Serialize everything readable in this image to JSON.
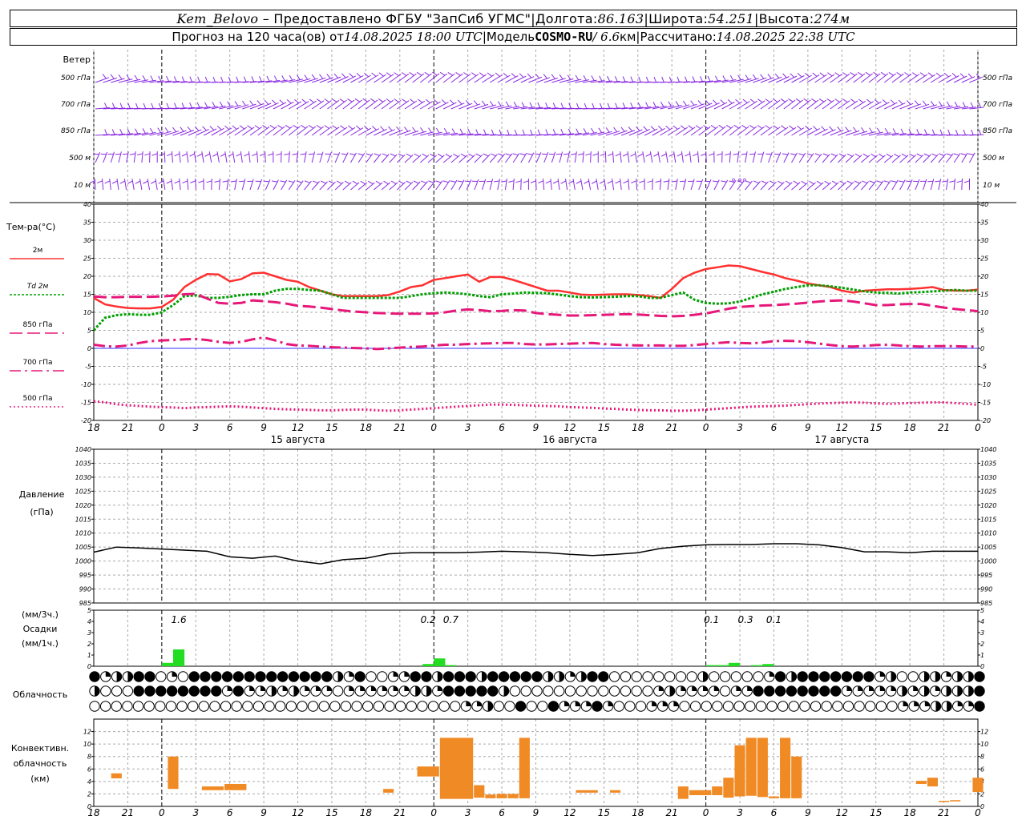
{
  "header": {
    "station": "Kem_Belovo",
    "sep0": " – ",
    "provided": "Предоставлено ФГБУ \"ЗапСиб УГМС\"",
    "lon_label": "Долгота:",
    "lon_value": "86.163",
    "lat_label": "Широта:",
    "lat_value": "54.251",
    "alt_label": "Высота:",
    "alt_value": "274м",
    "forecast_label": "Прогноз на 120 часа(ов) от",
    "forecast_from": "14.08.2025 18:00 UTC",
    "model_label": "Модель",
    "model_name": "COSMO-RU",
    "model_res": "/ 6.6",
    "model_res_unit": "км",
    "calc_label": "Рассчитано:",
    "calc_value": "14.08.2025 22:38 UTC",
    "bar": "|"
  },
  "colors": {
    "wind": "#8a2be2",
    "t2m": "#ff3030",
    "td2m": "#00a000",
    "t850": "#e6187a",
    "t700": "#e6187a",
    "t500": "#e6187a",
    "zero_line": "#3030ff",
    "precip": "#22dd22",
    "conv": "#f08a24",
    "grid": "#aaaaaa"
  },
  "chart_data": [
    {
      "type": "wind_barbs",
      "title": "Ветер",
      "levels": [
        "500 гПа",
        "700 гПа",
        "850 гПа",
        "500 м",
        "10  м"
      ],
      "x_ticks": [
        "18",
        "21",
        "0",
        "3",
        "6",
        "9",
        "12",
        "15",
        "18",
        "21",
        "0",
        "3",
        "6",
        "9",
        "12",
        "15",
        "18",
        "21",
        "0",
        "3",
        "6",
        "9",
        "12",
        "15",
        "18",
        "21",
        "0"
      ]
    },
    {
      "type": "line",
      "title": "Тем-ра(°C)",
      "ylim": [
        -20,
        40
      ],
      "y_ticks": [
        40,
        35,
        30,
        25,
        20,
        15,
        10,
        5,
        0,
        -5,
        -10,
        -15,
        -20
      ],
      "x_hours": [
        0,
        1,
        2,
        3,
        4,
        5,
        6,
        7,
        8,
        9,
        10,
        11,
        12,
        13,
        14,
        15,
        16,
        17,
        18,
        19,
        20,
        21,
        22,
        23,
        24,
        25,
        26,
        27,
        28,
        29,
        30,
        31,
        32,
        33,
        34,
        35,
        36,
        37,
        38,
        39,
        40,
        41,
        42,
        43,
        44,
        45,
        46,
        47,
        48,
        49,
        50,
        51,
        52,
        53,
        54,
        55,
        56,
        57,
        58,
        59,
        60,
        61,
        62,
        63,
        64,
        65,
        66,
        67,
        68,
        69,
        70,
        71,
        72,
        73,
        74,
        75,
        76,
        77,
        78
      ],
      "series": [
        {
          "name": "2м",
          "style": "solid",
          "values": [
            14,
            12.2,
            11.6,
            11.2,
            11.1,
            11.1,
            11.5,
            13.5,
            17,
            19,
            20.6,
            20.5,
            18.6,
            19.2,
            20.8,
            21,
            20,
            19,
            18.5,
            17,
            16,
            15,
            14.5,
            14.5,
            14.5,
            14.5,
            14.8,
            15.8,
            17,
            17.5,
            19,
            19.5,
            20,
            20.5,
            18.5,
            19.8,
            19.8,
            19,
            18,
            17,
            16,
            16,
            15.5,
            14.9,
            14.8,
            14.9,
            15,
            15,
            14.8,
            14.5,
            14,
            16.5,
            19.5,
            21,
            22,
            22.5,
            23,
            22.8,
            22,
            21.2,
            20.5,
            19.5,
            18.8,
            18,
            17.5,
            17,
            16,
            15.5,
            16,
            16.2,
            16.4,
            16.4,
            16.5,
            16.7,
            17,
            16.2,
            16,
            16,
            16.3
          ]
        },
        {
          "name": "Td  2м",
          "style": "dotted",
          "values": [
            5,
            8.5,
            9.2,
            9.5,
            9.3,
            9.3,
            10,
            12,
            14.5,
            14.7,
            14,
            14,
            14.3,
            14.8,
            15,
            15,
            16,
            16.5,
            16.5,
            16.2,
            16,
            15,
            14,
            14,
            14,
            14,
            14,
            14,
            14.5,
            15,
            15.3,
            15.5,
            15.3,
            15,
            14.5,
            14.2,
            15,
            15.2,
            15.5,
            15.4,
            15.3,
            14.9,
            14.5,
            14.2,
            14.1,
            14.2,
            14.3,
            14.5,
            14.5,
            14,
            14,
            14.8,
            15.5,
            13.5,
            12.6,
            12.4,
            12.5,
            13,
            14,
            15,
            15.7,
            16.5,
            17,
            17.5,
            17.5,
            17.2,
            16.8,
            16.3,
            15.8,
            15.5,
            15.4,
            15.2,
            15.5,
            15.6,
            15.8,
            16,
            16.2,
            16,
            16
          ]
        },
        {
          "name": "850 гПа",
          "style": "longdash",
          "values": [
            14.4,
            14.2,
            14.2,
            14.3,
            14.3,
            14.3,
            14.4,
            14.6,
            15,
            15.1,
            13.8,
            12.6,
            12.4,
            12.6,
            13.3,
            13.1,
            12.8,
            12.4,
            11.8,
            11.6,
            11.3,
            10.9,
            10.5,
            10.2,
            10,
            9.8,
            9.7,
            9.6,
            9.6,
            9.6,
            9.7,
            10,
            10.5,
            10.8,
            10.6,
            10.3,
            10.4,
            10.6,
            10.5,
            9.8,
            9.5,
            9.3,
            9.1,
            9.1,
            9.2,
            9.3,
            9.4,
            9.5,
            9.4,
            9.2,
            9.0,
            8.9,
            9.0,
            9.3,
            9.7,
            10.3,
            11,
            11.5,
            11.7,
            11.9,
            12,
            12.2,
            12.4,
            12.7,
            13,
            13.2,
            13.3,
            13,
            12.5,
            12,
            12,
            12.2,
            12.3,
            12.3,
            11.8,
            11.3,
            10.9,
            10.6,
            10.3
          ]
        },
        {
          "name": "700 гПа",
          "style": "dashdot",
          "values": [
            1.0,
            0.6,
            0.5,
            0.8,
            1.5,
            2,
            2.2,
            2.3,
            2.5,
            2.6,
            2.3,
            1.8,
            1.5,
            1.8,
            2.5,
            3,
            2.2,
            1.2,
            0.8,
            0.7,
            0.5,
            0.3,
            0.2,
            0.1,
            0,
            -0.2,
            0,
            0.2,
            0.4,
            0.5,
            0.8,
            1,
            1,
            1.2,
            1.3,
            1.4,
            1.5,
            1.5,
            1.2,
            1.1,
            1.1,
            1.2,
            1.3,
            1.4,
            1.5,
            1.2,
            1.0,
            0.9,
            0.8,
            0.8,
            0.8,
            0.7,
            0.7,
            0.9,
            1.2,
            1.5,
            1.7,
            1.5,
            1.4,
            1.6,
            2,
            2.1,
            2.0,
            1.7,
            1.3,
            0.9,
            0.6,
            0.5,
            0.7,
            0.9,
            1.0,
            0.8,
            0.6,
            0.5,
            0.6,
            0.6,
            0.6,
            0.5,
            0.5
          ]
        },
        {
          "name": "500 гПа",
          "style": "dotted2",
          "values": [
            -14.7,
            -15,
            -15.5,
            -15.8,
            -16,
            -16.2,
            -16.3,
            -16.4,
            -16.6,
            -16.4,
            -16.3,
            -16.2,
            -16.1,
            -16.2,
            -16.4,
            -16.6,
            -16.8,
            -16.9,
            -17,
            -17.1,
            -17.2,
            -17.2,
            -17.1,
            -17,
            -17,
            -17.2,
            -17.3,
            -17.2,
            -17,
            -16.8,
            -16.6,
            -16.4,
            -16.2,
            -16,
            -15.8,
            -15.6,
            -15.6,
            -15.7,
            -15.8,
            -15.9,
            -16,
            -16.1,
            -16.3,
            -16.4,
            -16.5,
            -16.7,
            -16.8,
            -17,
            -17.1,
            -17.2,
            -17.2,
            -17.3,
            -17.3,
            -17.2,
            -17,
            -16.8,
            -16.6,
            -16.4,
            -16.2,
            -16.1,
            -16,
            -15.9,
            -15.7,
            -15.5,
            -15.3,
            -15.2,
            -15.1,
            -15,
            -15.1,
            -15.3,
            -15.4,
            -15.3,
            -15.2,
            -15.1,
            -15,
            -15,
            -15.2,
            -15.4,
            -15.7
          ]
        }
      ],
      "x_ticks": [
        "18",
        "21",
        "0",
        "3",
        "6",
        "9",
        "12",
        "15",
        "18",
        "21",
        "0",
        "3",
        "6",
        "9",
        "12",
        "15",
        "18",
        "21",
        "0",
        "3",
        "6",
        "9",
        "12",
        "15",
        "18",
        "21",
        "0"
      ],
      "day_labels": [
        "15 августа",
        "16 августа",
        "17 августа"
      ]
    },
    {
      "type": "line",
      "title": "Давление",
      "ylabel": "(гПа)",
      "ylim": [
        985,
        1040
      ],
      "y_ticks": [
        1040,
        1035,
        1030,
        1025,
        1020,
        1015,
        1010,
        1005,
        1000,
        995,
        990,
        985
      ],
      "x_hours": [
        0,
        2,
        4,
        6,
        8,
        10,
        12,
        14,
        16,
        18,
        20,
        22,
        24,
        26,
        28,
        30,
        32,
        34,
        36,
        38,
        40,
        42,
        44,
        46,
        48,
        50,
        52,
        54,
        56,
        58,
        60,
        62,
        64,
        66,
        68,
        70,
        72,
        74,
        76,
        78
      ],
      "series": [
        {
          "name": "давление",
          "values": [
            1003.2,
            1005,
            1004.7,
            1004.3,
            1003.9,
            1003.5,
            1001.5,
            1001,
            1001.8,
            1000,
            999,
            1000.5,
            1001,
            1002.6,
            1003,
            1003,
            1003,
            1003.2,
            1003.5,
            1003.3,
            1003,
            1002.4,
            1002,
            1002.4,
            1003,
            1004.5,
            1005.3,
            1005.8,
            1005.9,
            1005.9,
            1006.2,
            1006.2,
            1005.8,
            1004.8,
            1003.3,
            1003.3,
            1003,
            1003.5,
            1003.5,
            1003.5
          ]
        }
      ]
    },
    {
      "type": "bar",
      "title": "Осадки",
      "ylabel_top": "(мм/3ч.)",
      "ylabel_bottom": "(мм/1ч.)",
      "ylim": [
        0,
        5
      ],
      "y_ticks": [
        5,
        4,
        3,
        2,
        1,
        0
      ],
      "bars": [
        {
          "h": 6.5,
          "v": 0.3
        },
        {
          "h": 7.5,
          "v": 1.5
        },
        {
          "h": 29.5,
          "v": 0.2
        },
        {
          "h": 30.5,
          "v": 0.7
        },
        {
          "h": 31.5,
          "v": 0.1
        },
        {
          "h": 54.5,
          "v": 0.1
        },
        {
          "h": 55.5,
          "v": 0.1
        },
        {
          "h": 56.5,
          "v": 0.3
        },
        {
          "h": 58.5,
          "v": 0.1
        },
        {
          "h": 59.5,
          "v": 0.2
        }
      ],
      "labels": [
        {
          "h": 7.5,
          "text": "1.6"
        },
        {
          "h": 29.5,
          "text": "0.2"
        },
        {
          "h": 31.5,
          "text": "0.7"
        },
        {
          "h": 54.5,
          "text": "0.1"
        },
        {
          "h": 57.5,
          "text": "0.3"
        },
        {
          "h": 60,
          "text": "0.1"
        }
      ]
    },
    {
      "type": "table",
      "title": "Облачность",
      "rows": [
        "fqhhffbqofffffffffffffhqfooqqffhfffhfffffhhqhffoooooooohoooooqfhfffffffqhoohhqhhf",
        "hoooffffffffqfqqhqhqqqoqqqqqqhhqfffffhoooooooooooooqhqqqqoqqffffffffqqqqqhqhqhhhf",
        "ooooooooooooooooooooooooooooooooooqqhoofoofqqqfqoooqqqooooooooooooooooooooqqqhhqqf"
      ],
      "legend": {
        "o": "ясно",
        "q": "мало",
        "h": "половина",
        "f": "сплошная"
      }
    },
    {
      "type": "bar",
      "title": "Конвективн.",
      "title2": "облачность",
      "ylabel": "(км)",
      "ylim": [
        0,
        14
      ],
      "y_ticks": [
        12,
        10,
        8,
        6,
        4,
        2,
        0
      ],
      "boxes": [
        {
          "h0": 1.5,
          "h1": 2.5,
          "bottom": 4.5,
          "top": 5.3
        },
        {
          "h0": 6.5,
          "h1": 7.5,
          "bottom": 2.8,
          "top": 8
        },
        {
          "h0": 9.5,
          "h1": 11.5,
          "bottom": 2.6,
          "top": 3.2
        },
        {
          "h0": 11.5,
          "h1": 13.5,
          "bottom": 2.6,
          "top": 3.6
        },
        {
          "h0": 25.5,
          "h1": 26.5,
          "bottom": 2.2,
          "top": 2.8
        },
        {
          "h0": 28.5,
          "h1": 30.5,
          "bottom": 4.8,
          "top": 6.4
        },
        {
          "h0": 30.5,
          "h1": 33.5,
          "bottom": 1.2,
          "top": 11
        },
        {
          "h0": 33.5,
          "h1": 34.5,
          "bottom": 1.4,
          "top": 3.4
        },
        {
          "h0": 34.5,
          "h1": 35.5,
          "bottom": 1.3,
          "top": 1.9
        },
        {
          "h0": 35.5,
          "h1": 36.5,
          "bottom": 1.3,
          "top": 2
        },
        {
          "h0": 36.5,
          "h1": 37.5,
          "bottom": 1.3,
          "top": 2
        },
        {
          "h0": 37.5,
          "h1": 38.5,
          "bottom": 1.3,
          "top": 11
        },
        {
          "h0": 42.5,
          "h1": 44.5,
          "bottom": 2.2,
          "top": 2.6
        },
        {
          "h0": 45.5,
          "h1": 46.5,
          "bottom": 2.2,
          "top": 2.6
        },
        {
          "h0": 51.5,
          "h1": 52.5,
          "bottom": 1.2,
          "top": 3.2
        },
        {
          "h0": 52.5,
          "h1": 54.5,
          "bottom": 1.8,
          "top": 2.6
        },
        {
          "h0": 54.5,
          "h1": 55.5,
          "bottom": 1.8,
          "top": 3.2
        },
        {
          "h0": 55.5,
          "h1": 56.5,
          "bottom": 1.4,
          "top": 4.6
        },
        {
          "h0": 56.5,
          "h1": 57.5,
          "bottom": 1.6,
          "top": 9.8
        },
        {
          "h0": 57.5,
          "h1": 58.5,
          "bottom": 1.7,
          "top": 11
        },
        {
          "h0": 58.5,
          "h1": 59.5,
          "bottom": 1.5,
          "top": 11
        },
        {
          "h0": 59.5,
          "h1": 60.5,
          "bottom": 1.3,
          "top": 1.6
        },
        {
          "h0": 60.5,
          "h1": 61.5,
          "bottom": 1.3,
          "top": 11
        },
        {
          "h0": 61.5,
          "h1": 62.5,
          "bottom": 1.3,
          "top": 8
        },
        {
          "h0": 72.5,
          "h1": 73.5,
          "bottom": 3.6,
          "top": 4.1
        },
        {
          "h0": 73.5,
          "h1": 74.5,
          "bottom": 3.2,
          "top": 4.6
        },
        {
          "h0": 74.5,
          "h1": 75.5,
          "bottom": 0.7,
          "top": 0.9
        },
        {
          "h0": 75.5,
          "h1": 76.5,
          "bottom": 0.8,
          "top": 1
        },
        {
          "h0": 77.5,
          "h1": 78.5,
          "bottom": 2.3,
          "top": 4.6
        }
      ]
    }
  ],
  "wind_obs": {
    "calm_marks": [
      "°",
      "°°"
    ]
  }
}
